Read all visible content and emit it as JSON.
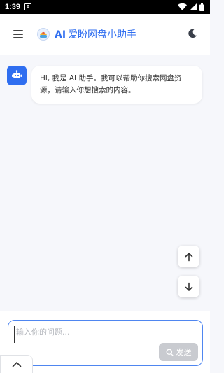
{
  "status_bar": {
    "time": "1:39",
    "notification_icon": "A"
  },
  "header": {
    "title_ai": "AI",
    "title_text": "爱盼网盘小助手",
    "icons": [
      "menu-icon",
      "logo-icon",
      "moon-icon"
    ]
  },
  "chat": {
    "messages": [
      {
        "role": "assistant",
        "text": "Hi, 我是 AI 助手。我可以帮助你搜索网盘资源，请输入你想搜索的内容。"
      }
    ]
  },
  "scroll_controls": {
    "icons": [
      "arrow-up-icon",
      "arrow-down-icon"
    ]
  },
  "composer": {
    "placeholder": "输入你的问题...",
    "value": "",
    "send_label": "发送"
  },
  "colors": {
    "accent": "#2f6ef0",
    "background": "#f6f7fb",
    "send_disabled": "#c9cbd0"
  }
}
